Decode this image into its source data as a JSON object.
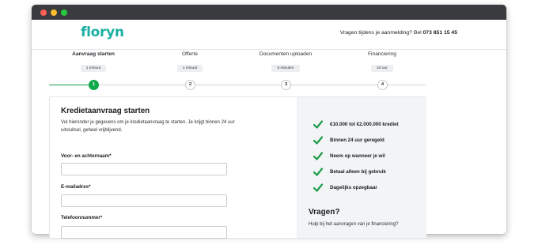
{
  "window": {
    "buttons": [
      "close",
      "minimize",
      "maximize"
    ]
  },
  "header": {
    "logo": "floryn",
    "help_text": "Vragen tijdens je aanmelding? Bel",
    "phone": "073 851 15 45"
  },
  "steps": [
    {
      "title": "Aanvraag starten",
      "duration": "1 minuut",
      "number": "1",
      "active": true
    },
    {
      "title": "Offerte",
      "duration": "1 minuut",
      "number": "2",
      "active": false
    },
    {
      "title": "Documenten uploaden",
      "duration": "5 minuten",
      "number": "3",
      "active": false
    },
    {
      "title": "Financiering",
      "duration": "24 uur",
      "number": "4",
      "active": false
    }
  ],
  "progress": {
    "current_step": 1,
    "total_steps": 4
  },
  "form": {
    "title": "Kredietaanvraag starten",
    "description": "Vul hieronder je gegevens om je kredietaanvraag te starten. Je krijgt binnen 24 uur uitsluitsel, geheel vrijblijvend.",
    "fields": [
      {
        "label": "Voor- en achternaam*",
        "value": "",
        "placeholder": ""
      },
      {
        "label": "E-mailadres*",
        "value": "",
        "placeholder": ""
      },
      {
        "label": "Telefoonnummer*",
        "value": "",
        "placeholder": ""
      }
    ]
  },
  "sidebar": {
    "benefits": [
      "€10.000 tot €2.000.000 krediet",
      "Binnen 24 uur geregeld",
      "Neem op wanneer je wil",
      "Betaal alleen bij gebruik",
      "Dagelijks opzegbaar"
    ],
    "questions_title": "Vragen?",
    "questions_text": "Hulp bij het aanvragen van je financiering?"
  },
  "colors": {
    "brand": "#1bb0a3",
    "accent_green": "#0fa84a",
    "check_green": "#1a9c4b",
    "titlebar": "#3a3b3e"
  },
  "icons": {
    "benefit": "checkmark-icon"
  }
}
